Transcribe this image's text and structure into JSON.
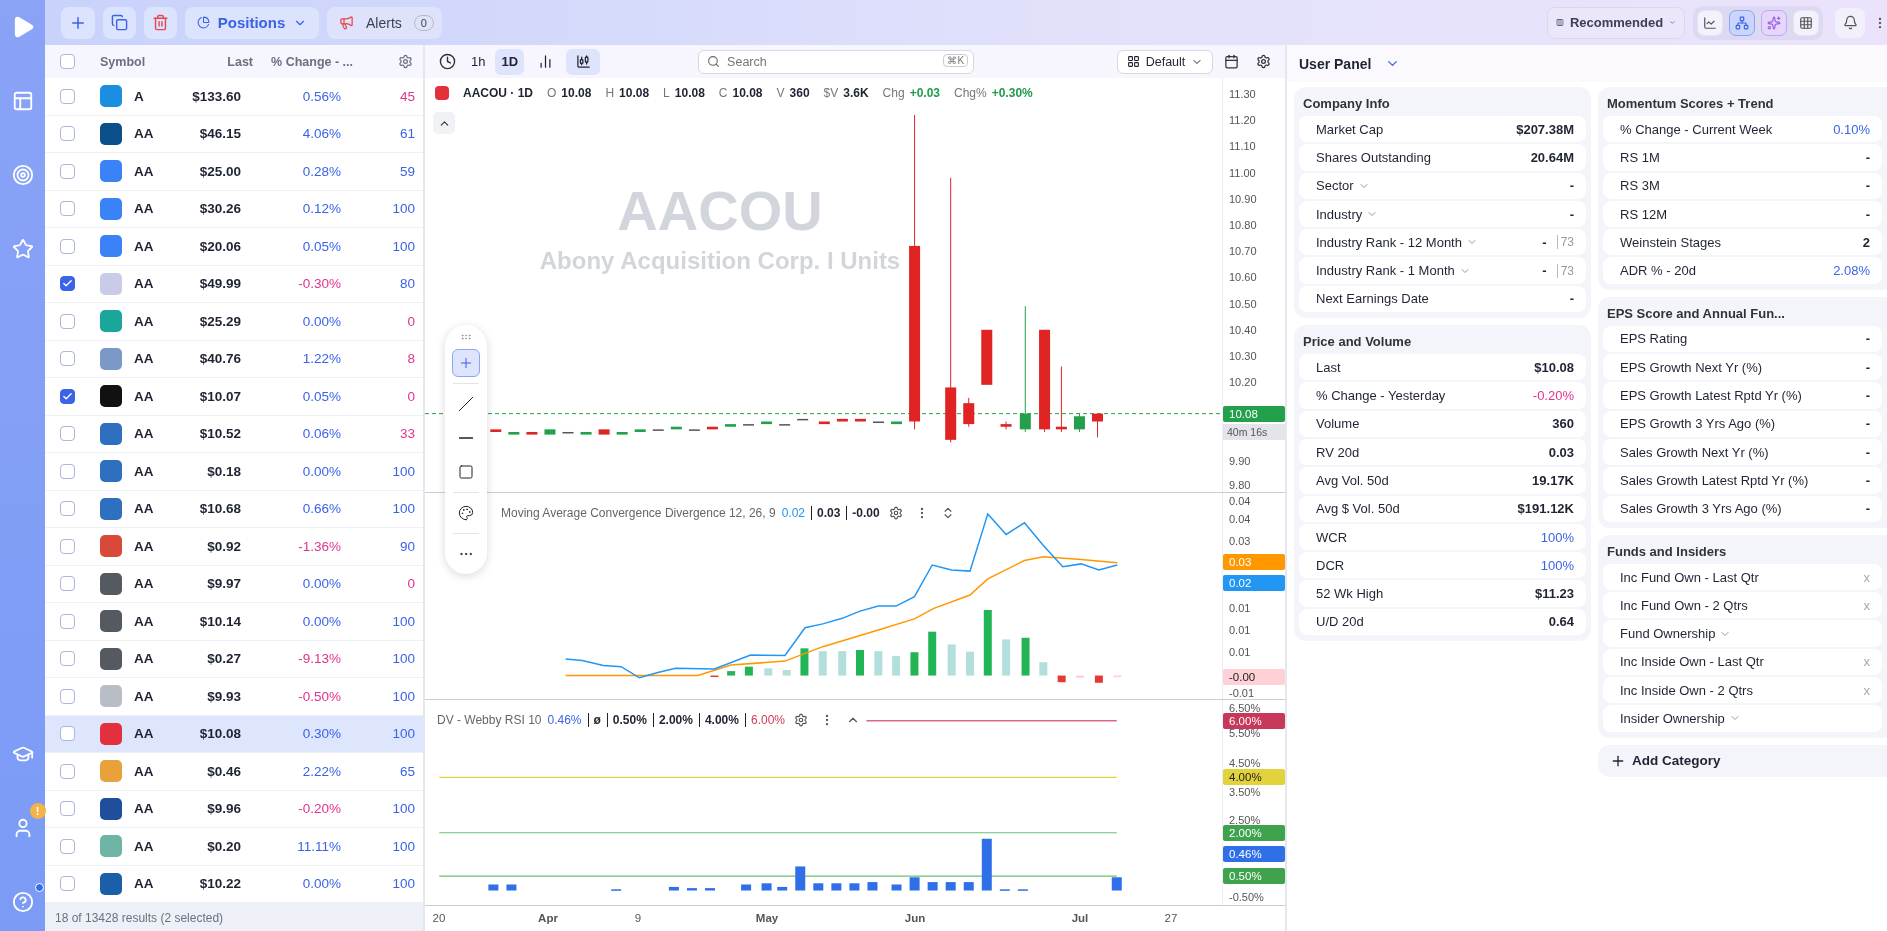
{
  "nav": {
    "alert_badge": "!"
  },
  "toolbar": {
    "view": "Positions",
    "alerts": {
      "label": "Alerts",
      "count": "0"
    },
    "layout": "Recommended",
    "panel_views": [
      {
        "kind": "chart",
        "selected": false
      },
      {
        "kind": "network",
        "selected": true
      },
      {
        "kind": "ai",
        "selected": false
      },
      {
        "kind": "grid",
        "selected": false
      }
    ]
  },
  "watchlist": {
    "all_checked": false,
    "columns": [
      "Symbol",
      "Last",
      "% Change - ..."
    ],
    "rows": [
      {
        "symbol": "A",
        "last": "$133.60",
        "change": {
          "text": "0.56%",
          "color": "#3a63e8"
        },
        "column_4": {
          "text": "45",
          "color": "#e0338e"
        },
        "checked": false,
        "selected": false
      },
      {
        "symbol": "AA",
        "last": "$46.15",
        "change": {
          "text": "4.06%",
          "color": "#3a63e8"
        },
        "column_4": {
          "text": "61",
          "color": "#3a63e8"
        },
        "checked": false,
        "selected": false
      },
      {
        "symbol": "AA",
        "last": "$25.00",
        "change": {
          "text": "0.28%",
          "color": "#3a63e8"
        },
        "column_4": {
          "text": "59",
          "color": "#3a63e8"
        },
        "checked": false,
        "selected": false
      },
      {
        "symbol": "AA",
        "last": "$30.26",
        "change": {
          "text": "0.12%",
          "color": "#3a63e8"
        },
        "column_4": {
          "text": "100",
          "color": "#3a63e8"
        },
        "checked": false,
        "selected": false
      },
      {
        "symbol": "AA",
        "last": "$20.06",
        "change": {
          "text": "0.05%",
          "color": "#3a63e8"
        },
        "column_4": {
          "text": "100",
          "color": "#3a63e8"
        },
        "checked": false,
        "selected": false
      },
      {
        "symbol": "AA",
        "last": "$49.99",
        "change": {
          "text": "-0.30%",
          "color": "#e0338e"
        },
        "column_4": {
          "text": "80",
          "color": "#3a63e8"
        },
        "checked": true,
        "selected": false
      },
      {
        "symbol": "AA",
        "last": "$25.29",
        "change": {
          "text": "0.00%",
          "color": "#3a63e8"
        },
        "column_4": {
          "text": "0",
          "color": "#e0338e"
        },
        "checked": false,
        "selected": false
      },
      {
        "symbol": "AA",
        "last": "$40.76",
        "change": {
          "text": "1.22%",
          "color": "#3a63e8"
        },
        "column_4": {
          "text": "8",
          "color": "#e0338e"
        },
        "checked": false,
        "selected": false
      },
      {
        "symbol": "AA",
        "last": "$10.07",
        "change": {
          "text": "0.05%",
          "color": "#3a63e8"
        },
        "column_4": {
          "text": "0",
          "color": "#e0338e"
        },
        "checked": true,
        "selected": false
      },
      {
        "symbol": "AA",
        "last": "$10.52",
        "change": {
          "text": "0.06%",
          "color": "#3a63e8"
        },
        "column_4": {
          "text": "33",
          "color": "#e0338e"
        },
        "checked": false,
        "selected": false
      },
      {
        "symbol": "AA",
        "last": "$0.18",
        "change": {
          "text": "0.00%",
          "color": "#3a63e8"
        },
        "column_4": {
          "text": "100",
          "color": "#3a63e8"
        },
        "checked": false,
        "selected": false
      },
      {
        "symbol": "AA",
        "last": "$10.68",
        "change": {
          "text": "0.66%",
          "color": "#3a63e8"
        },
        "column_4": {
          "text": "100",
          "color": "#3a63e8"
        },
        "checked": false,
        "selected": false
      },
      {
        "symbol": "AA",
        "last": "$0.92",
        "change": {
          "text": "-1.36%",
          "color": "#e0338e"
        },
        "column_4": {
          "text": "90",
          "color": "#3a63e8"
        },
        "checked": false,
        "selected": false
      },
      {
        "symbol": "AA",
        "last": "$9.97",
        "change": {
          "text": "0.00%",
          "color": "#3a63e8"
        },
        "column_4": {
          "text": "0",
          "color": "#e0338e"
        },
        "checked": false,
        "selected": false
      },
      {
        "symbol": "AA",
        "last": "$10.14",
        "change": {
          "text": "0.00%",
          "color": "#3a63e8"
        },
        "column_4": {
          "text": "100",
          "color": "#3a63e8"
        },
        "checked": false,
        "selected": false
      },
      {
        "symbol": "AA",
        "last": "$0.27",
        "change": {
          "text": "-9.13%",
          "color": "#e0338e"
        },
        "column_4": {
          "text": "100",
          "color": "#3a63e8"
        },
        "checked": false,
        "selected": false
      },
      {
        "symbol": "AA",
        "last": "$9.93",
        "change": {
          "text": "-0.50%",
          "color": "#e0338e"
        },
        "column_4": {
          "text": "100",
          "color": "#3a63e8"
        },
        "checked": false,
        "selected": false
      },
      {
        "symbol": "AA",
        "last": "$10.08",
        "change": {
          "text": "0.30%",
          "color": "#3a63e8"
        },
        "column_4": {
          "text": "100",
          "color": "#3a63e8"
        },
        "checked": false,
        "selected": true
      },
      {
        "symbol": "AA",
        "last": "$0.46",
        "change": {
          "text": "2.22%",
          "color": "#3a63e8"
        },
        "column_4": {
          "text": "65",
          "color": "#3a63e8"
        },
        "checked": false,
        "selected": false
      },
      {
        "symbol": "AA",
        "last": "$9.96",
        "change": {
          "text": "-0.20%",
          "color": "#e0338e"
        },
        "column_4": {
          "text": "100",
          "color": "#3a63e8"
        },
        "checked": false,
        "selected": false
      },
      {
        "symbol": "AA",
        "last": "$0.20",
        "change": {
          "text": "11.11%",
          "color": "#3a63e8"
        },
        "column_4": {
          "text": "100",
          "color": "#3a63e8"
        },
        "checked": false,
        "selected": false
      },
      {
        "symbol": "AA",
        "last": "$10.22",
        "change": {
          "text": "0.00%",
          "color": "#3a63e8"
        },
        "column_4": {
          "text": "100",
          "color": "#3a63e8"
        },
        "checked": false,
        "selected": false
      }
    ],
    "footer": "18 of 13428 results (2 selected)"
  },
  "chart": {
    "intervals": [
      {
        "label": "1h",
        "selected": false
      },
      {
        "label": "1D",
        "selected": true
      }
    ],
    "chart_types": [
      {
        "kind": "bars",
        "selected": false
      },
      {
        "kind": "candles",
        "selected": true
      }
    ],
    "search": {
      "placeholder": "Search",
      "shortcut": "⌘K"
    },
    "layout": "Default",
    "legend": {
      "symbol": "AACOU · 1D",
      "fields": [
        {
          "key": "O",
          "value": "10.08",
          "color": "#1f2433"
        },
        {
          "key": "H",
          "value": "10.08",
          "color": "#1f2433"
        },
        {
          "key": "L",
          "value": "10.08",
          "color": "#1f2433"
        },
        {
          "key": "C",
          "value": "10.08",
          "color": "#1f2433"
        },
        {
          "key": "V",
          "value": "360",
          "color": "#1f2433"
        },
        {
          "key": "$V",
          "value": "3.6K",
          "color": "#1f2433"
        },
        {
          "key": "Chg",
          "value": "+0.03",
          "color": "#1f9d4a"
        },
        {
          "key": "Chg%",
          "value": "+0.30%",
          "color": "#1f9d4a"
        }
      ]
    },
    "watermark": {
      "ticker": "AACOU",
      "name": "Abony Acquisition Corp. I Units"
    },
    "price_axis": [
      {
        "label": "11.30",
        "kind": "tick"
      },
      {
        "label": "11.20",
        "kind": "tick"
      },
      {
        "label": "11.10",
        "kind": "tick"
      },
      {
        "label": "11.00",
        "kind": "tick"
      },
      {
        "label": "10.90",
        "kind": "tick"
      },
      {
        "label": "10.80",
        "kind": "tick"
      },
      {
        "label": "10.70",
        "kind": "tick"
      },
      {
        "label": "10.60",
        "kind": "tick"
      },
      {
        "label": "10.50",
        "kind": "tick"
      },
      {
        "label": "10.40",
        "kind": "tick"
      },
      {
        "label": "10.30",
        "kind": "tick"
      },
      {
        "label": "10.20",
        "kind": "tick"
      },
      {
        "label": "10.08",
        "kind": "tag",
        "color": "#22a04b"
      },
      {
        "label": "40m 16s",
        "kind": "timer"
      },
      {
        "label": "9.90",
        "kind": "tick"
      },
      {
        "label": "9.80",
        "kind": "tick"
      }
    ],
    "drawing_tools": [
      {
        "kind": "crosshair",
        "selected": true
      },
      {
        "kind": "line",
        "selected": false
      },
      {
        "kind": "hline",
        "selected": false
      },
      {
        "kind": "rect",
        "selected": false
      },
      {
        "kind": "palette",
        "selected": false
      },
      {
        "kind": "more",
        "selected": false
      }
    ],
    "macd": {
      "title": "Moving Average Convergence Divergence 12, 26, 9",
      "values": [
        {
          "text": "0.02",
          "color": "#2196f3"
        },
        {
          "text": "0.03",
          "color": "#1f2433"
        },
        {
          "text": "-0.00",
          "color": "#1f2433"
        }
      ],
      "axis": [
        {
          "label": "0.04",
          "kind": "tick"
        },
        {
          "label": "0.04",
          "kind": "tick"
        },
        {
          "label": "0.03",
          "kind": "tick"
        },
        {
          "label": "0.03",
          "kind": "tag",
          "color": "#ff9800"
        },
        {
          "label": "0.02",
          "kind": "tag",
          "color": "#2196f3"
        },
        {
          "label": "0.01",
          "kind": "tick"
        },
        {
          "label": "0.01",
          "kind": "tick"
        },
        {
          "label": "0.01",
          "kind": "tick"
        },
        {
          "label": "-0.00",
          "kind": "tag",
          "color": "#ffd0d6"
        },
        {
          "label": "-0.01",
          "kind": "tick"
        }
      ]
    },
    "rsi": {
      "title": "DV - Webby RSI 10",
      "values": [
        {
          "text": "0.46%",
          "color": "#3a63e8"
        },
        {
          "text": "ø",
          "color": "#1f2433"
        },
        {
          "text": "0.50%",
          "color": "#1f2433"
        },
        {
          "text": "2.00%",
          "color": "#1f2433"
        },
        {
          "text": "4.00%",
          "color": "#1f2433"
        },
        {
          "text": "6.00%",
          "color": "#d23a5a"
        }
      ],
      "axis": [
        {
          "label": "6.50%",
          "kind": "tick"
        },
        {
          "label": "6.00%",
          "kind": "tag",
          "color": "#c8385a"
        },
        {
          "label": "5.50%",
          "kind": "tick"
        },
        {
          "label": "4.50%",
          "kind": "tick"
        },
        {
          "label": "4.00%",
          "kind": "tag",
          "color": "#e2d33c"
        },
        {
          "label": "3.50%",
          "kind": "tick"
        },
        {
          "label": "2.50%",
          "kind": "tick"
        },
        {
          "label": "2.00%",
          "kind": "tag",
          "color": "#3fa34d"
        },
        {
          "label": "0.46%",
          "kind": "tag",
          "color": "#2f6fe8"
        },
        {
          "label": "0.50%",
          "kind": "tag",
          "color": "#3fa34d"
        },
        {
          "label": "-0.50%",
          "kind": "tick"
        }
      ]
    },
    "time_axis": [
      {
        "label": "20",
        "month": false
      },
      {
        "label": "Apr",
        "month": true
      },
      {
        "label": "9",
        "month": false
      },
      {
        "label": "May",
        "month": true
      },
      {
        "label": "Jun",
        "month": true
      },
      {
        "label": "Jul",
        "month": true
      },
      {
        "label": "27",
        "month": false
      }
    ]
  },
  "user_panel": {
    "title": "User Panel",
    "columns": [
      [
        {
          "title": "Company Info",
          "rows": [
            {
              "label": "Market Cap",
              "value": "$207.38M",
              "color": "#1f2433",
              "dropdown": false
            },
            {
              "label": "Shares Outstanding",
              "value": "20.64M",
              "color": "#1f2433",
              "dropdown": false
            },
            {
              "label": "Sector",
              "value": "-",
              "dropdown": true
            },
            {
              "label": "Industry",
              "value": "-",
              "dropdown": true
            },
            {
              "label": "Industry Rank - 12 Month",
              "value": "-",
              "rank": "73",
              "dropdown": true
            },
            {
              "label": "Industry Rank - 1 Month",
              "value": "-",
              "rank": "73",
              "dropdown": true
            },
            {
              "label": "Next Earnings Date",
              "value": "-",
              "dropdown": false
            }
          ]
        },
        {
          "title": "Price and Volume",
          "rows": [
            {
              "label": "Last",
              "value": "$10.08",
              "color": "#1f2433",
              "dropdown": false
            },
            {
              "label": "% Change - Yesterday",
              "value": "-0.20%",
              "color": "#e0338e",
              "dropdown": false
            },
            {
              "label": "Volume",
              "value": "360",
              "color": "#1f2433",
              "dropdown": false
            },
            {
              "label": "RV 20d",
              "value": "0.03",
              "color": "#1f2433",
              "dropdown": false
            },
            {
              "label": "Avg Vol. 50d",
              "value": "19.17K",
              "color": "#1f2433",
              "dropdown": false
            },
            {
              "label": "Avg $ Vol. 50d",
              "value": "$191.12K",
              "color": "#1f2433",
              "dropdown": false
            },
            {
              "label": "WCR",
              "value": "100%",
              "color": "#3a63e8",
              "dropdown": false
            },
            {
              "label": "DCR",
              "value": "100%",
              "color": "#3a63e8",
              "dropdown": false
            },
            {
              "label": "52 Wk High",
              "value": "$11.23",
              "color": "#1f2433",
              "dropdown": false
            },
            {
              "label": "U/D 20d",
              "value": "0.64",
              "color": "#1f2433",
              "dropdown": false
            }
          ]
        }
      ],
      [
        {
          "title": "Momentum Scores + Trend",
          "rows": [
            {
              "label": "% Change - Current Week",
              "value": "0.10%",
              "color": "#3a63e8",
              "dropdown": false
            },
            {
              "label": "RS 1M",
              "value": "-",
              "dropdown": false
            },
            {
              "label": "RS 3M",
              "value": "-",
              "dropdown": false
            },
            {
              "label": "RS 12M",
              "value": "-",
              "dropdown": false
            },
            {
              "label": "Weinstein Stages",
              "value": "2",
              "color": "#1f2433",
              "dropdown": false
            },
            {
              "label": "ADR % - 20d",
              "value": "2.08%",
              "color": "#3a63e8",
              "dropdown": false
            }
          ]
        },
        {
          "title": "EPS Score and Annual Fun...",
          "rows": [
            {
              "label": "EPS Rating",
              "value": "-",
              "dropdown": false
            },
            {
              "label": "EPS Growth Next Yr (%)",
              "value": "-",
              "dropdown": false
            },
            {
              "label": "EPS Growth Latest Rptd Yr (%)",
              "value": "-",
              "dropdown": false
            },
            {
              "label": "EPS Growth 3 Yrs Ago (%)",
              "value": "-",
              "dropdown": false
            },
            {
              "label": "Sales Growth Next Yr (%)",
              "value": "-",
              "dropdown": false
            },
            {
              "label": "Sales Growth Latest Rptd Yr (%)",
              "value": "-",
              "dropdown": false
            },
            {
              "label": "Sales Growth 3 Yrs Ago (%)",
              "value": "-",
              "dropdown": false
            }
          ]
        },
        {
          "title": "Funds and Insiders",
          "rows": [
            {
              "label": "Inc Fund Own - Last Qtr",
              "remove": "x",
              "dropdown": false
            },
            {
              "label": "Inc Fund Own - 2 Qtrs",
              "remove": "x",
              "dropdown": false
            },
            {
              "label": "Fund Ownership",
              "dropdown": true
            },
            {
              "label": "Inc Inside Own - Last Qtr",
              "remove": "x",
              "dropdown": false
            },
            {
              "label": "Inc Inside Own - 2 Qtrs",
              "remove": "x",
              "dropdown": false
            },
            {
              "label": "Insider Ownership",
              "dropdown": true
            }
          ]
        }
      ]
    ],
    "add_category": "Add Category"
  }
}
